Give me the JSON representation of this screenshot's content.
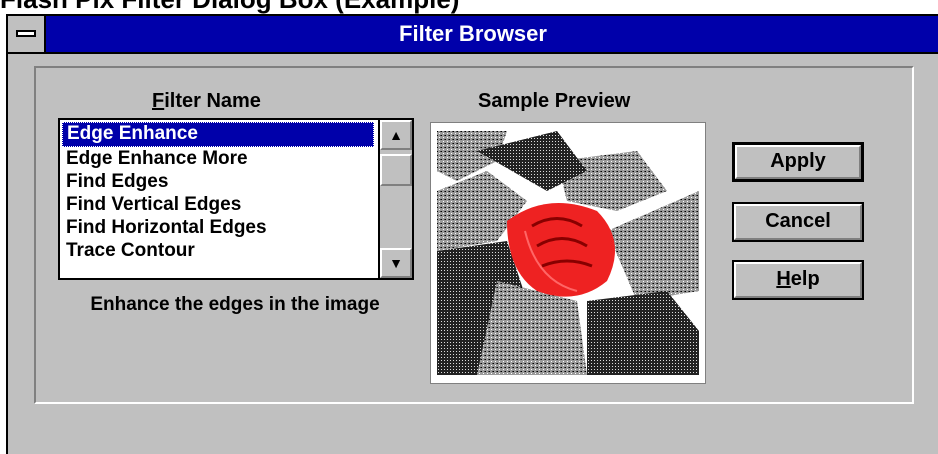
{
  "caption": "Flash Pix Filter Dialog Box (Example)",
  "window": {
    "title": "Filter Browser"
  },
  "filter_list": {
    "label": "Filter Name",
    "items": [
      {
        "label": "Edge Enhance",
        "selected": true
      },
      {
        "label": "Edge Enhance More"
      },
      {
        "label": "Find Edges"
      },
      {
        "label": "Find Vertical Edges"
      },
      {
        "label": "Find Horizontal Edges"
      },
      {
        "label": "Trace Contour"
      }
    ],
    "description": "Enhance the edges in the image"
  },
  "preview": {
    "label": "Sample Preview"
  },
  "buttons": {
    "apply": "Apply",
    "cancel": "Cancel",
    "help": "Help"
  },
  "icons": {
    "scroll_up": "arrow-up-icon",
    "scroll_down": "arrow-down-icon",
    "system_menu": "system-menu-icon"
  },
  "colors": {
    "titlebar": "#0000aa",
    "face": "#c0c0c0",
    "selection": "#0000aa",
    "rose": "#ee2222"
  }
}
